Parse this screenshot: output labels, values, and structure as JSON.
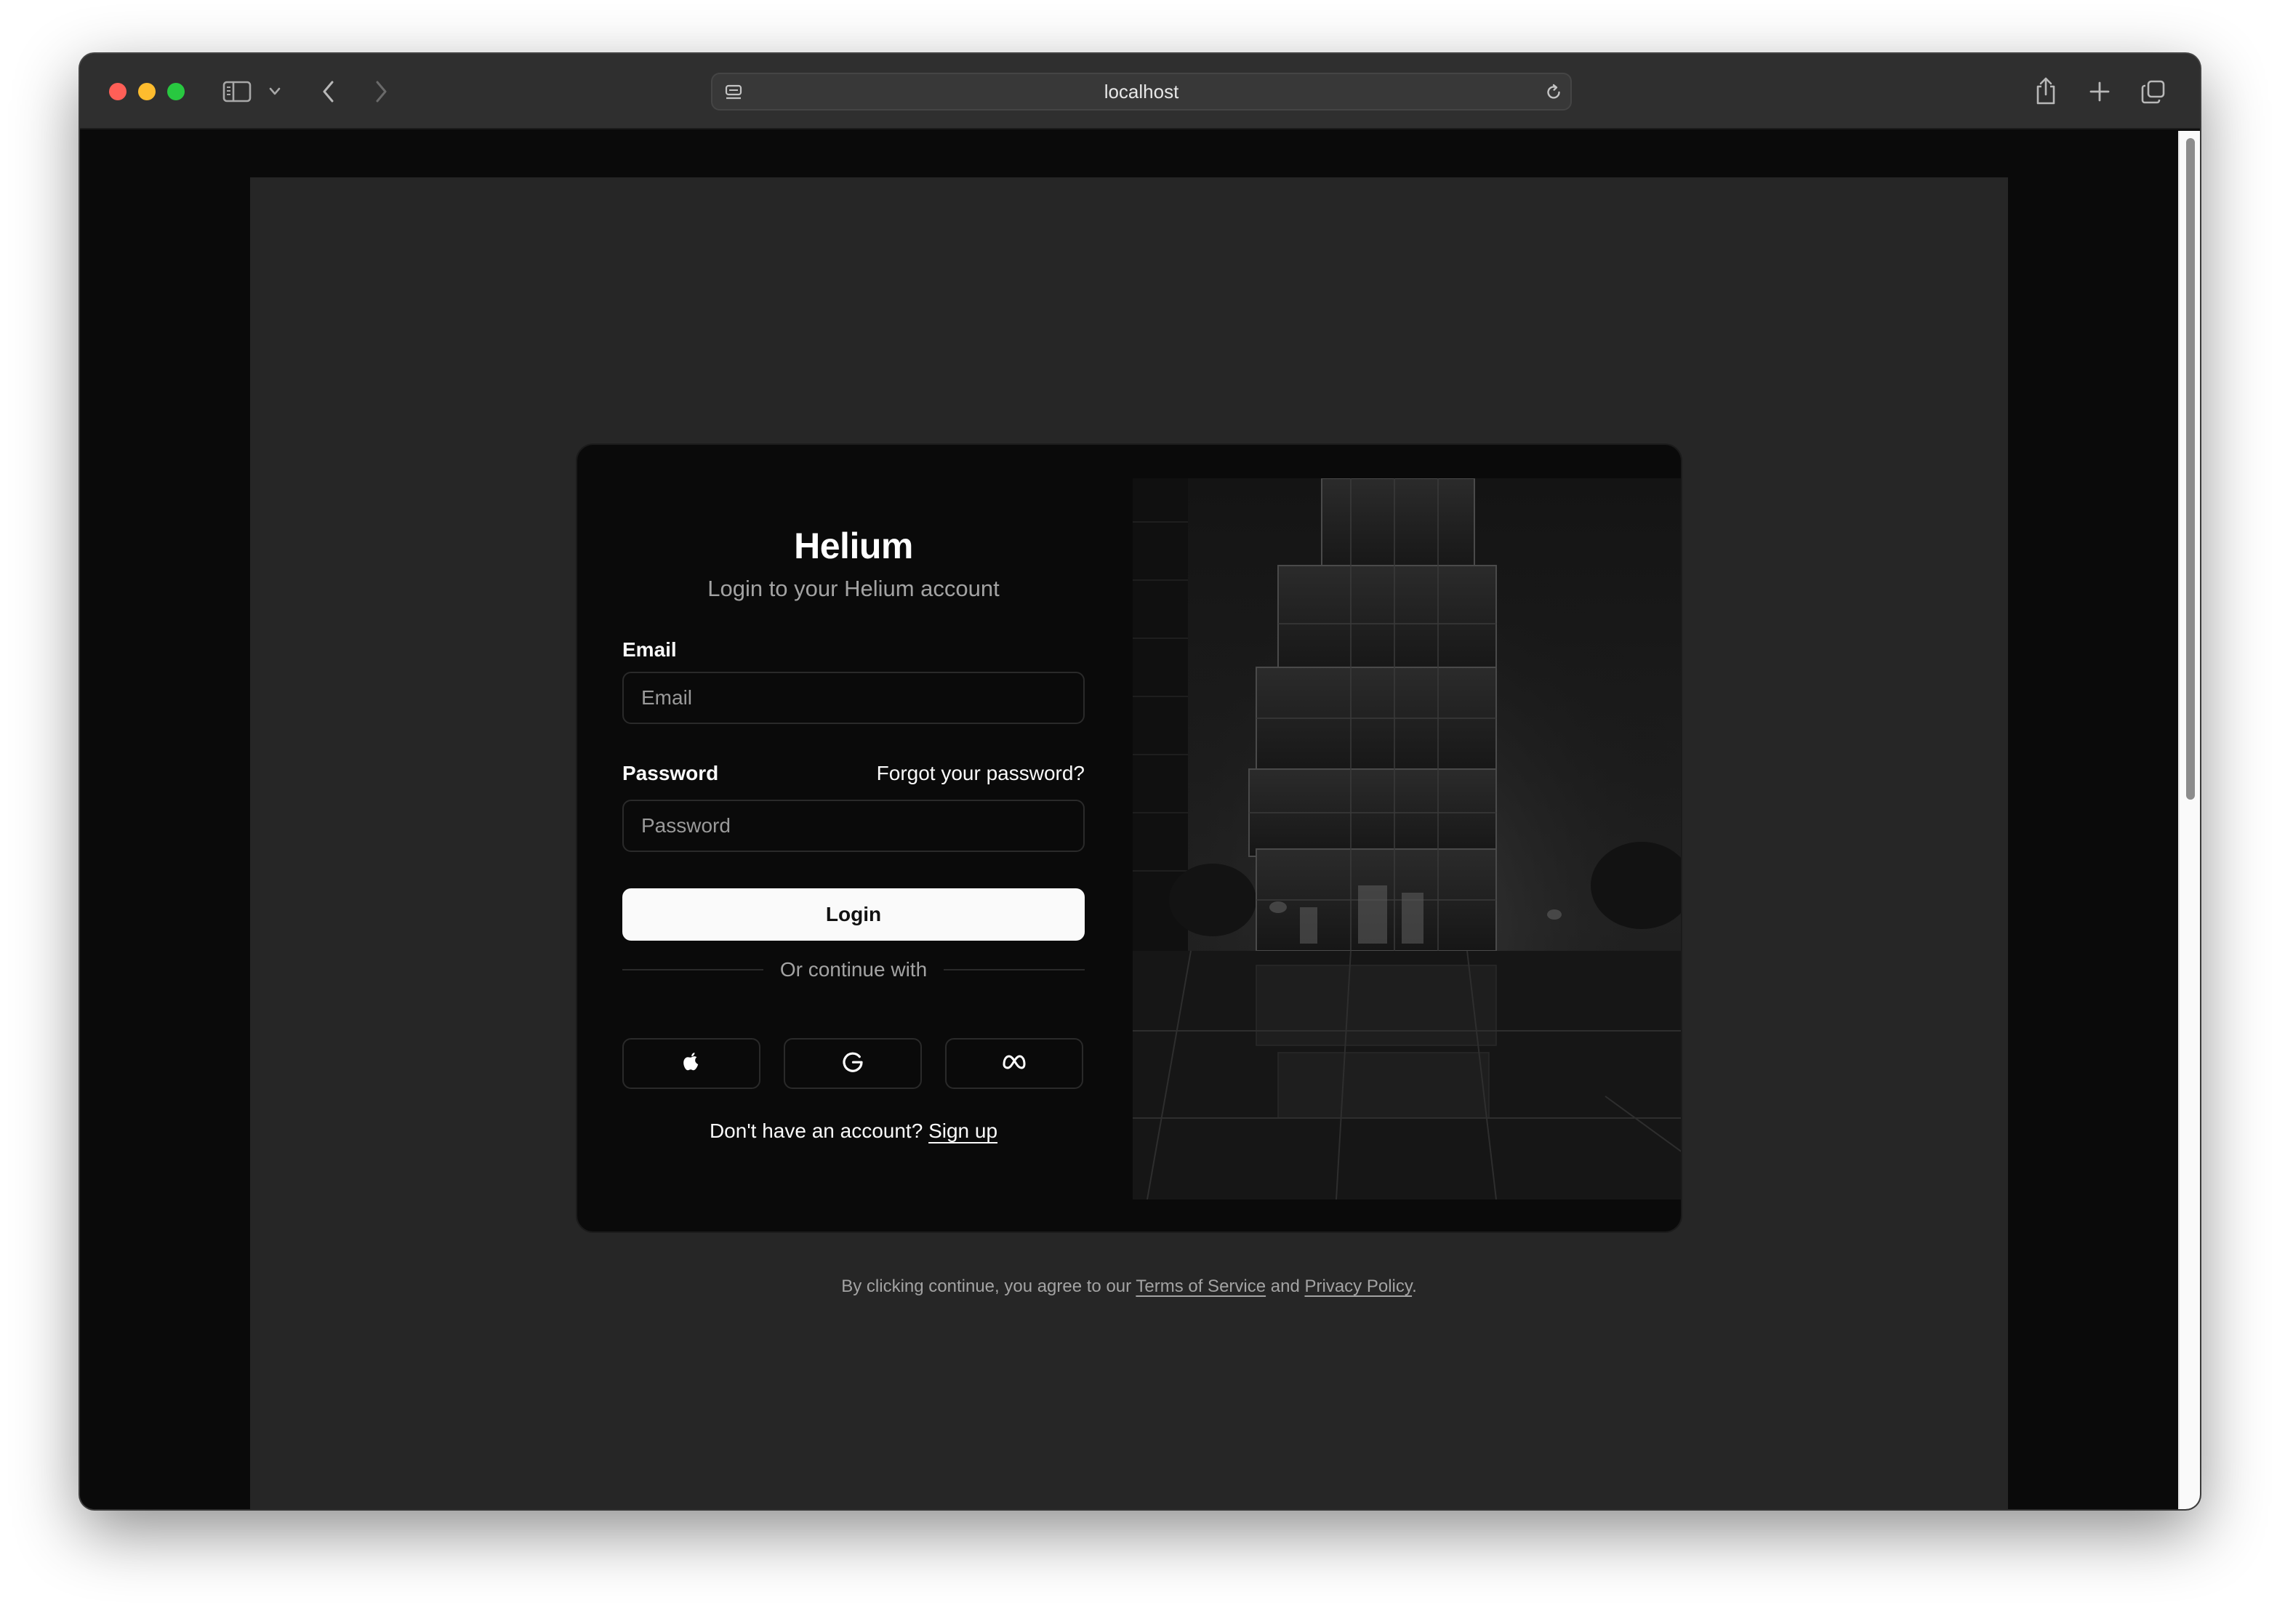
{
  "browser": {
    "url": "localhost",
    "traffic_lights": {
      "close": "#ff5f57",
      "minimize": "#febc2e",
      "zoom": "#28c840"
    }
  },
  "login": {
    "title": "Helium",
    "subtitle": "Login to your Helium account",
    "email_label": "Email",
    "email_placeholder": "Email",
    "password_label": "Password",
    "forgot_password": "Forgot your password?",
    "password_placeholder": "Password",
    "login_button": "Login",
    "divider_text": "Or continue with",
    "social_buttons": [
      {
        "icon": "apple-icon"
      },
      {
        "icon": "google-icon"
      },
      {
        "icon": "meta-icon"
      }
    ],
    "signup_prompt": "Don't have an account?",
    "signup_link": "Sign up"
  },
  "footer": {
    "prefix": "By clicking continue, you agree to our",
    "terms_link": "Terms of Service",
    "and": "and",
    "privacy_link": "Privacy Policy",
    "suffix": "."
  },
  "theme": {
    "page_background": "#262626",
    "card_background": "#0a0a0a",
    "primary_button": "#fafafa",
    "muted_text": "#a3a3a3"
  }
}
